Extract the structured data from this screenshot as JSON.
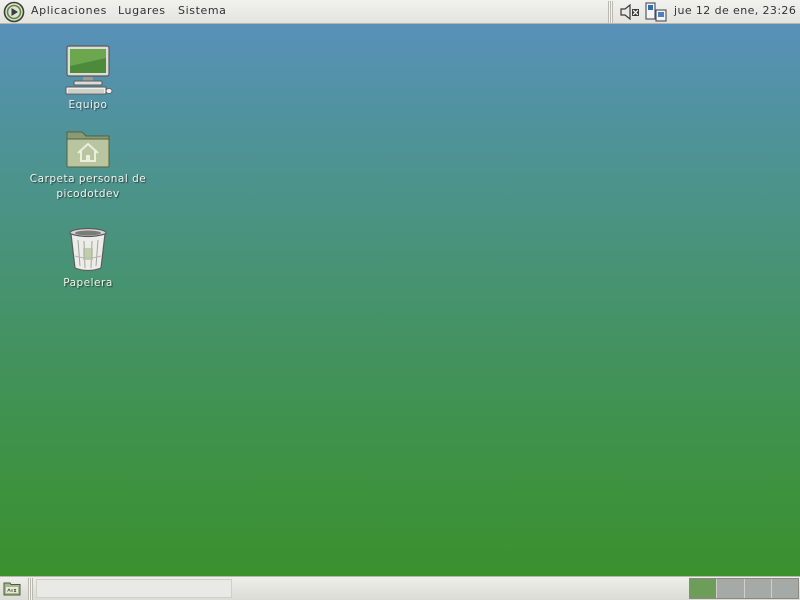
{
  "top_panel": {
    "menus": {
      "applications": "Aplicaciones",
      "places": "Lugares",
      "system": "Sistema"
    },
    "clock": "jue 12 de ene, 23:26",
    "tray_icons": [
      "volume-muted-icon",
      "network-icon"
    ]
  },
  "desktop": {
    "background_colors": {
      "top": "#5a90c0",
      "bottom": "#3a9128"
    },
    "icons": [
      {
        "label": "Equipo",
        "icon": "computer-icon"
      },
      {
        "label": "Carpeta personal de picodotdev",
        "icon": "home-folder-icon"
      },
      {
        "label": "Papelera",
        "icon": "trash-icon"
      }
    ]
  },
  "bottom_panel": {
    "show_desktop_icon": "show-desktop-icon",
    "workspaces": [
      {
        "index": 1,
        "active": true
      },
      {
        "index": 2,
        "active": false
      },
      {
        "index": 3,
        "active": false
      },
      {
        "index": 4,
        "active": false
      }
    ],
    "accent_color": "#6c9e5a"
  }
}
